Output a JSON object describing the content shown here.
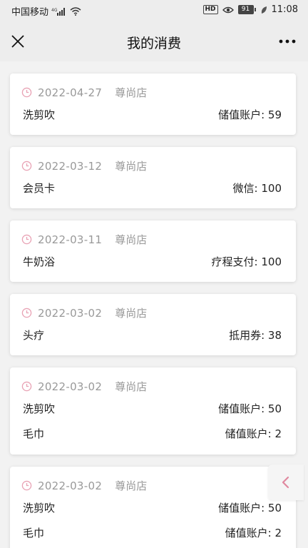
{
  "status_bar": {
    "carrier": "中国移动",
    "network_badge": "HD",
    "battery": "91",
    "time": "11:08"
  },
  "nav": {
    "title": "我的消费"
  },
  "colors": {
    "accent_pink": "#e8a2b4",
    "text_gray": "#999999"
  },
  "orders": [
    {
      "date": "2022-04-27",
      "store": "尊尚店",
      "items": [
        {
          "name": "洗剪吹",
          "payment": "储值账户: 59"
        }
      ]
    },
    {
      "date": "2022-03-12",
      "store": "尊尚店",
      "items": [
        {
          "name": "会员卡",
          "payment": "微信: 100"
        }
      ]
    },
    {
      "date": "2022-03-11",
      "store": "尊尚店",
      "items": [
        {
          "name": "牛奶浴",
          "payment": "疗程支付: 100"
        }
      ]
    },
    {
      "date": "2022-03-02",
      "store": "尊尚店",
      "items": [
        {
          "name": "头疗",
          "payment": "抵用券: 38"
        }
      ]
    },
    {
      "date": "2022-03-02",
      "store": "尊尚店",
      "items": [
        {
          "name": "洗剪吹",
          "payment": "储值账户: 50"
        },
        {
          "name": "毛巾",
          "payment": "储值账户: 2"
        }
      ]
    },
    {
      "date": "2022-03-02",
      "store": "尊尚店",
      "items": [
        {
          "name": "洗剪吹",
          "payment": "储值账户: 50"
        },
        {
          "name": "毛巾",
          "payment": "储值账户: 2"
        }
      ]
    }
  ]
}
